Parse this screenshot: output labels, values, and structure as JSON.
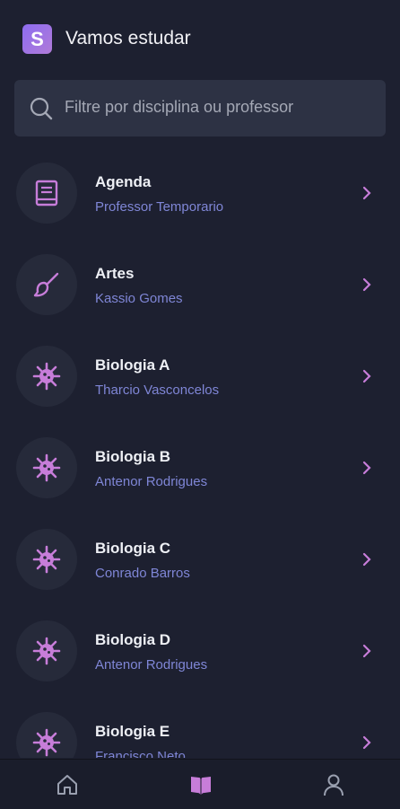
{
  "header": {
    "logo_letter": "S",
    "title": "Vamos estudar"
  },
  "search": {
    "placeholder": "Filtre por disciplina ou professor",
    "icon": "search-icon"
  },
  "subjects": [
    {
      "name": "Agenda",
      "teacher": "Professor Temporario",
      "icon": "book-icon"
    },
    {
      "name": "Artes",
      "teacher": "Kassio Gomes",
      "icon": "paintbrush-icon"
    },
    {
      "name": "Biologia A",
      "teacher": "Tharcio Vasconcelos",
      "icon": "virus-icon"
    },
    {
      "name": "Biologia B",
      "teacher": "Antenor Rodrigues",
      "icon": "virus-icon"
    },
    {
      "name": "Biologia C",
      "teacher": "Conrado Barros",
      "icon": "virus-icon"
    },
    {
      "name": "Biologia D",
      "teacher": "Antenor Rodrigues",
      "icon": "virus-icon"
    },
    {
      "name": "Biologia E",
      "teacher": "Francisco Neto",
      "icon": "virus-icon"
    }
  ],
  "tabbar": {
    "tabs": [
      {
        "icon": "home-icon",
        "active": false
      },
      {
        "icon": "open-book-icon",
        "active": true
      },
      {
        "icon": "profile-icon",
        "active": false
      }
    ]
  },
  "colors": {
    "background": "#1d2030",
    "accent": "#c77dd9",
    "teacher_text": "#7f86d6",
    "search_bg": "#2d3244"
  }
}
